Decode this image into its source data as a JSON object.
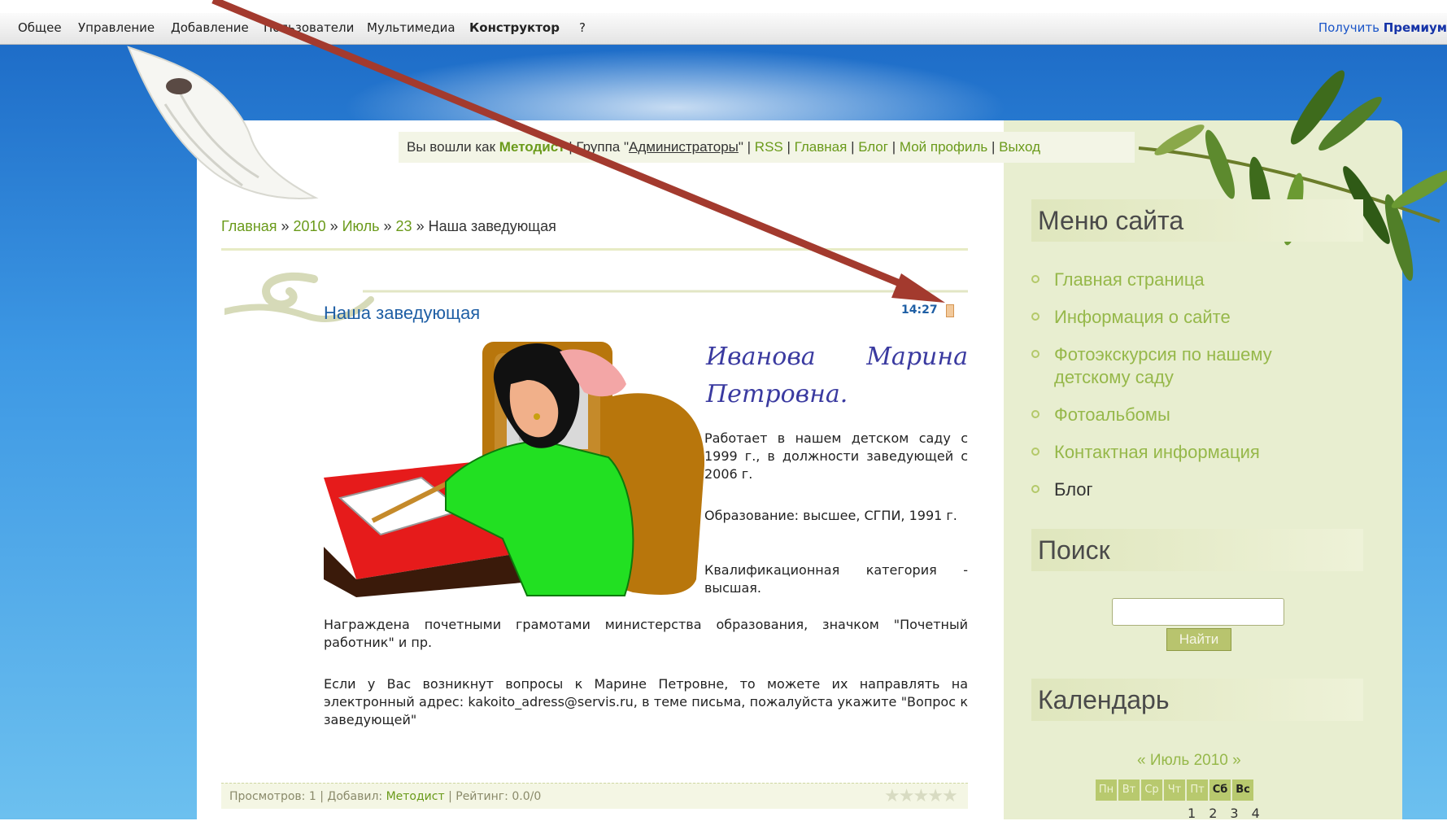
{
  "toolbar": {
    "items": [
      "Общее",
      "Управление",
      "Добавление",
      "Пользователи",
      "Мультимедиа",
      "Конструктор",
      "?"
    ],
    "premium_prefix": "Получить",
    "premium_bold": "Премиум"
  },
  "loginbar": {
    "prefix": "Вы вошли как",
    "user": "Методист",
    "group_prefix": "| Группа \"",
    "group": "Администраторы",
    "group_suffix": "\" |",
    "links": [
      "RSS",
      "Главная",
      "Блог",
      "Мой профиль",
      "Выход"
    ]
  },
  "breadcrumb": {
    "home": "Главная",
    "year": "2010",
    "month": "Июль",
    "day": "23",
    "current": "Наша заведующая",
    "sep": " » "
  },
  "post": {
    "title": "Наша заведующая",
    "time": "14:27",
    "name_line1_a": "Иванова",
    "name_line1_b": "Марина",
    "name_line2": "Петровна.",
    "para1": "Работает в нашем детском саду с 1999 г., в должности заведующей с 2006 г.",
    "para2": "Образование: высшее, СГПИ, 1991 г.",
    "para3": "Квалификационная категория - высшая.",
    "para4": "Награждена почетными грамотами министерства образования, значком \"Почетный работник\" и пр.",
    "para5": "Если у Вас возникнут вопросы к Марине Петровне, то можете их направлять на электронный адрес: kakoito_adress@servis.ru, в теме письма, пожалуйста укажите \"Вопрос к заведующей\""
  },
  "post_footer": {
    "views_label": "Просмотров:",
    "views": "1",
    "added_label": "Добавил:",
    "added_by": "Методист",
    "rating_label": "Рейтинг:",
    "rating": "0.0/0"
  },
  "sidebar": {
    "menu_title": "Меню сайта",
    "menu_items": [
      "Главная страница",
      "Информация о сайте",
      "Фотоэкскурсия по нашему детскому саду",
      "Фотоальбомы",
      "Контактная информация",
      "Блог"
    ],
    "search_title": "Поиск",
    "search_button": "Найти",
    "calendar_title": "Календарь",
    "calendar_month": "« Июль 2010 »",
    "weekdays": [
      "Пн",
      "Вт",
      "Ср",
      "Чт",
      "Пт",
      "Сб",
      "Вс"
    ],
    "days": [
      "1",
      "2",
      "3",
      "4"
    ]
  },
  "colors": {
    "sky": "#3d98e4",
    "link_green": "#6a9a1a",
    "title_blue": "#1f5fa5",
    "sidebar_bg": "#e8eed0",
    "arrow": "#a33a2e"
  },
  "icons": [
    "dove-image",
    "olive-branch-image",
    "woman-at-desk-illustration",
    "bullet-icon",
    "star-icon",
    "arrow-annotation"
  ]
}
